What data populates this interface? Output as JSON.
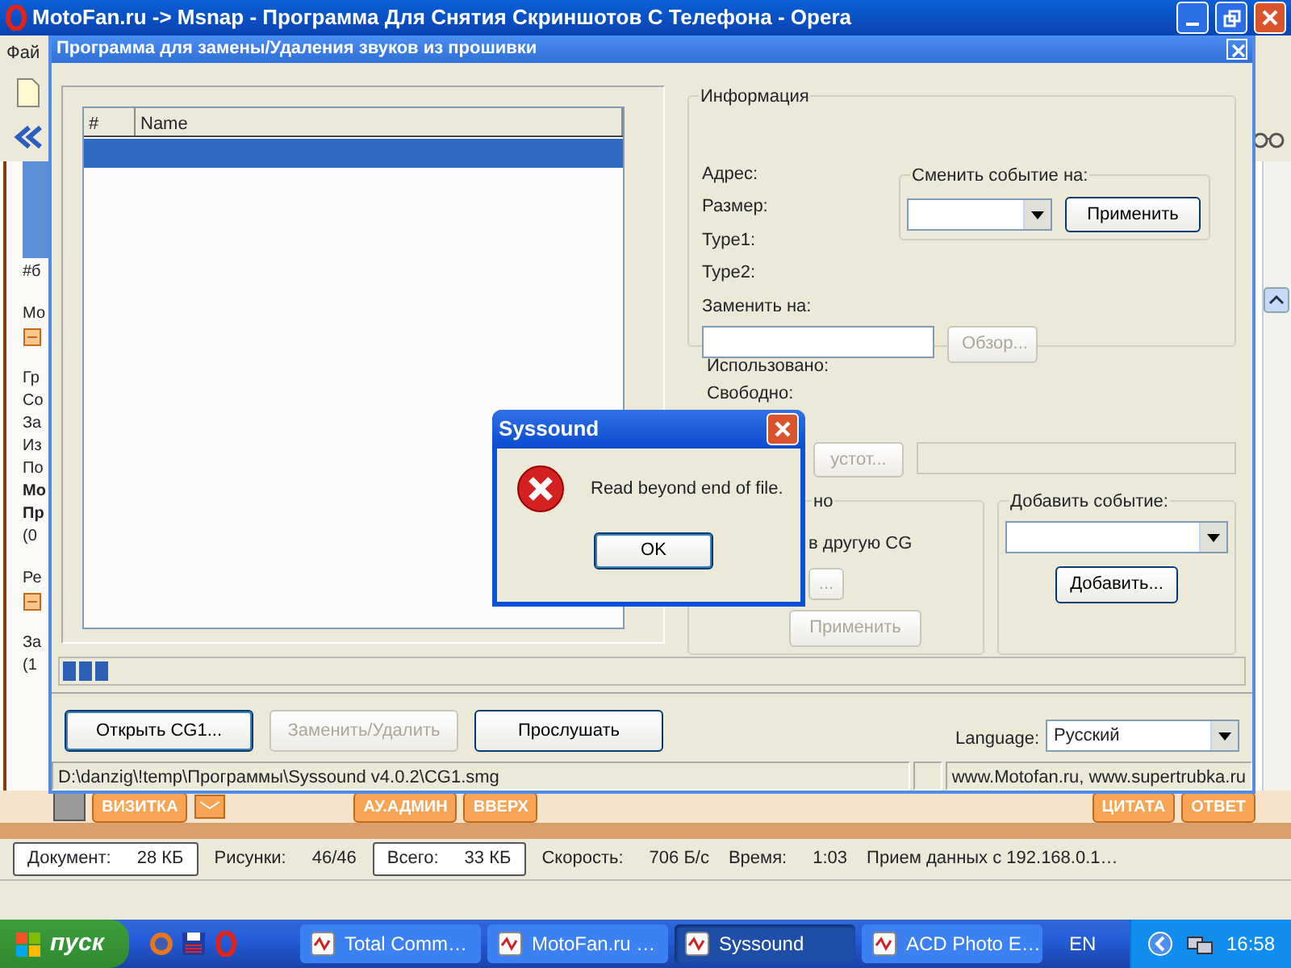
{
  "browser_window": {
    "title": "MotoFan.ru -> Msnap - Программа Для Снятия Скриншотов С Телефона - Opera",
    "menu_fragment": "Фай",
    "page_fragments": [
      {
        "kind": "text",
        "text": "#б",
        "bold": false
      },
      {
        "kind": "gap"
      },
      {
        "kind": "text",
        "text": "Мо",
        "bold": false
      },
      {
        "kind": "icon"
      },
      {
        "kind": "gap"
      },
      {
        "kind": "text",
        "text": "Гр",
        "bold": false
      },
      {
        "kind": "text",
        "text": "Со",
        "bold": false
      },
      {
        "kind": "text",
        "text": "За",
        "bold": false
      },
      {
        "kind": "text",
        "text": "Из",
        "bold": false
      },
      {
        "kind": "text",
        "text": "По",
        "bold": false
      },
      {
        "kind": "text",
        "text": "Мо",
        "bold": true
      },
      {
        "kind": "text",
        "text": "Пр",
        "bold": true
      },
      {
        "kind": "text",
        "text": "(0",
        "bold": false
      },
      {
        "kind": "gap"
      },
      {
        "kind": "text",
        "text": "Ре",
        "bold": false
      },
      {
        "kind": "icon"
      },
      {
        "kind": "gap"
      },
      {
        "kind": "text",
        "text": "За",
        "bold": false
      },
      {
        "kind": "text",
        "text": "(1",
        "bold": false
      }
    ],
    "page_buttons_left": [
      "ВИЗИТКА",
      "АУ.АДМИН",
      "ВВЕРХ"
    ],
    "page_buttons_right": [
      "ЦИТАТА",
      "ОТВЕТ"
    ],
    "status_bar": [
      {
        "label": "Документ:",
        "value": "28 КБ",
        "boxed": true
      },
      {
        "label": "Рисунки:",
        "value": "46/46",
        "boxed": false
      },
      {
        "label": "Всего:",
        "value": "33 КБ",
        "boxed": true
      },
      {
        "label": "Скорость:",
        "value": "706 Б/с",
        "boxed": false
      },
      {
        "label": "Время:",
        "value": "1:03",
        "boxed": false
      },
      {
        "label": "Прием данных с 192.168.0.1…",
        "boxed": false
      }
    ]
  },
  "dialog": {
    "title": "Программа для замены/Удаления звуков из прошивки",
    "list": {
      "columns": [
        "#",
        "Name"
      ],
      "rows": [
        {
          "selected": true
        }
      ]
    },
    "info": {
      "title": "Информация",
      "fields": [
        "Адрес:",
        "Размер:",
        "Type1:",
        "Type2:"
      ],
      "replace_label": "Заменить на:",
      "browse_button": {
        "label": "Обзор...",
        "disabled": true
      }
    },
    "change_event": {
      "title": "Сменить событие на:",
      "apply_button": {
        "label": "Применить",
        "disabled": false
      }
    },
    "used_label": "Использовано:",
    "free_label": "Свободно:",
    "space_button": {
      "label": "устот...",
      "disabled": true
    },
    "move_group": {
      "title": "но",
      "option": "в другую CG",
      "browse_button": {
        "label": "...",
        "disabled": true
      },
      "apply_button": {
        "label": "Применить",
        "disabled": true
      }
    },
    "add_event": {
      "title": "Добавить событие:",
      "add_button": {
        "label": "Добавить...",
        "disabled": false
      }
    },
    "progress": {
      "level": 0.04
    },
    "buttons": [
      {
        "label": "Открыть CG1...",
        "disabled": false,
        "default": true
      },
      {
        "label": "Заменить/Удалить",
        "disabled": true,
        "default": false
      },
      {
        "label": "Прослушать",
        "disabled": false,
        "default": false
      }
    ],
    "language": {
      "label": "Language:",
      "value": "Русский"
    },
    "status_bar": [
      "D:\\danzig\\!temp\\Программы\\Syssound v4.0.2\\CG1.smg",
      "www.Motofan.ru, www.supertrubka.ru"
    ]
  },
  "message_box": {
    "title": "Syssound",
    "message": "Read beyond end of file.",
    "button": "OK"
  },
  "taskbar": {
    "start": "пуск",
    "tasks": [
      {
        "label": "Total Comm…",
        "selected": false
      },
      {
        "label": "MotoFan.ru …",
        "selected": false
      },
      {
        "label": "Syssound",
        "selected": true
      },
      {
        "label": "ACD Photo E…",
        "selected": false
      }
    ],
    "language": "EN",
    "clock": "16:58"
  }
}
